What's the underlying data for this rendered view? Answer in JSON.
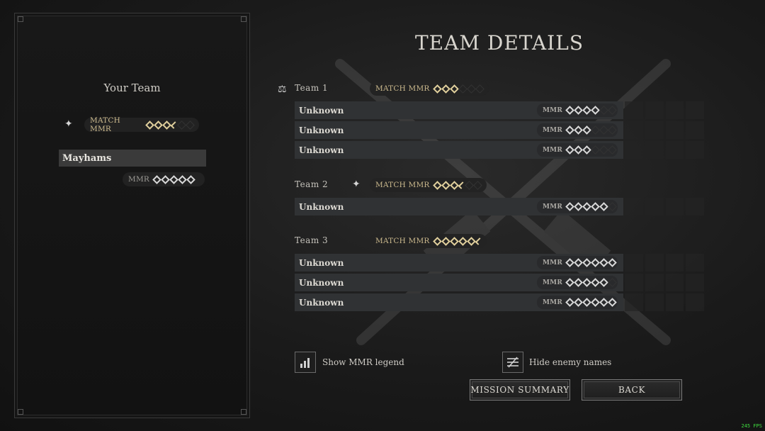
{
  "left_panel": {
    "title": "Your Team",
    "match_mmr_label": "MATCH MMR",
    "match_mmr_stars": {
      "full": 3,
      "half": 1,
      "empty": 2
    },
    "player": {
      "name": "Mayhams",
      "mmr_label": "MMR",
      "mmr_stars": 5
    }
  },
  "main": {
    "title": "TEAM DETAILS",
    "teams": [
      {
        "name": "Team 1",
        "match_mmr_label": "MATCH MMR",
        "match_mmr_stars": {
          "full": 3,
          "half": 0,
          "empty": 3
        },
        "players": [
          {
            "name": "Unknown",
            "mmr_label": "MMR",
            "stars": 4,
            "empty": 2
          },
          {
            "name": "Unknown",
            "mmr_label": "MMR",
            "stars": 3,
            "empty": 3
          },
          {
            "name": "Unknown",
            "mmr_label": "MMR",
            "stars": 3,
            "empty": 3
          }
        ]
      },
      {
        "name": "Team 2",
        "match_mmr_label": "MATCH MMR",
        "match_mmr_stars": {
          "full": 3,
          "half": 1,
          "empty": 2
        },
        "players": [
          {
            "name": "Unknown",
            "mmr_label": "MMR",
            "stars": 5,
            "empty": 1
          }
        ]
      },
      {
        "name": "Team 3",
        "match_mmr_label": "MATCH MMR",
        "match_mmr_stars": {
          "full": 5,
          "half": 1,
          "empty": 0
        },
        "players": [
          {
            "name": "Unknown",
            "mmr_label": "MMR",
            "stars": 6,
            "empty": 0
          },
          {
            "name": "Unknown",
            "mmr_label": "MMR",
            "stars": 5,
            "empty": 1
          },
          {
            "name": "Unknown",
            "mmr_label": "MMR",
            "stars": 6,
            "empty": 0
          }
        ]
      }
    ]
  },
  "options": {
    "show_mmr_legend": "Show MMR legend",
    "hide_enemy_names": "Hide enemy names"
  },
  "buttons": {
    "mission_summary": "MISSION SUMMARY",
    "back": "BACK"
  },
  "fps": "245 FPS",
  "colors": {
    "gold": "#e0cf9c",
    "row_bg": "#303234",
    "fps": "#3fdc3f"
  }
}
